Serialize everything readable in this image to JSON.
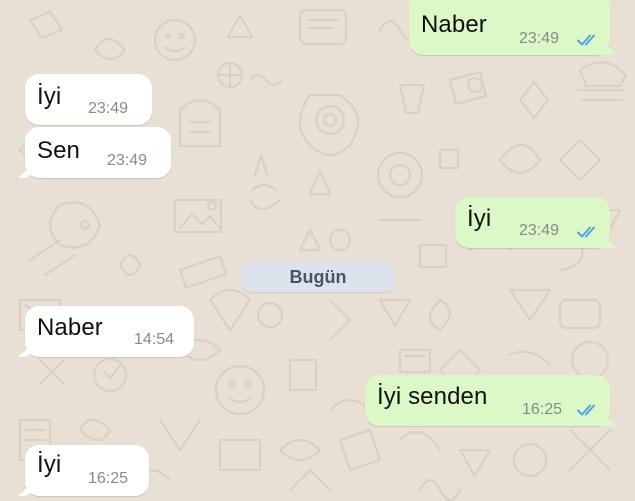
{
  "colors": {
    "background": "#e9e0d5",
    "incoming_bubble": "#ffffff",
    "outgoing_bubble": "#dcf8c6",
    "read_ticks": "#4fa3e6",
    "date_chip": "#dde3ec"
  },
  "date_separator": "Bugün",
  "messages": [
    {
      "direction": "outgoing",
      "text": "Naber",
      "time": "23:49",
      "status_icon": "double-check-read-icon"
    },
    {
      "direction": "incoming",
      "text": "İyi",
      "time": "23:49"
    },
    {
      "direction": "incoming",
      "text": "Sen",
      "time": "23:49"
    },
    {
      "direction": "outgoing",
      "text": "İyi",
      "time": "23:49",
      "status_icon": "double-check-read-icon"
    },
    {
      "direction": "incoming",
      "text": "Naber",
      "time": "14:54"
    },
    {
      "direction": "outgoing",
      "text": "İyi senden",
      "time": "16:25",
      "status_icon": "double-check-read-icon"
    },
    {
      "direction": "incoming",
      "text": "İyi",
      "time": "16:25"
    }
  ]
}
